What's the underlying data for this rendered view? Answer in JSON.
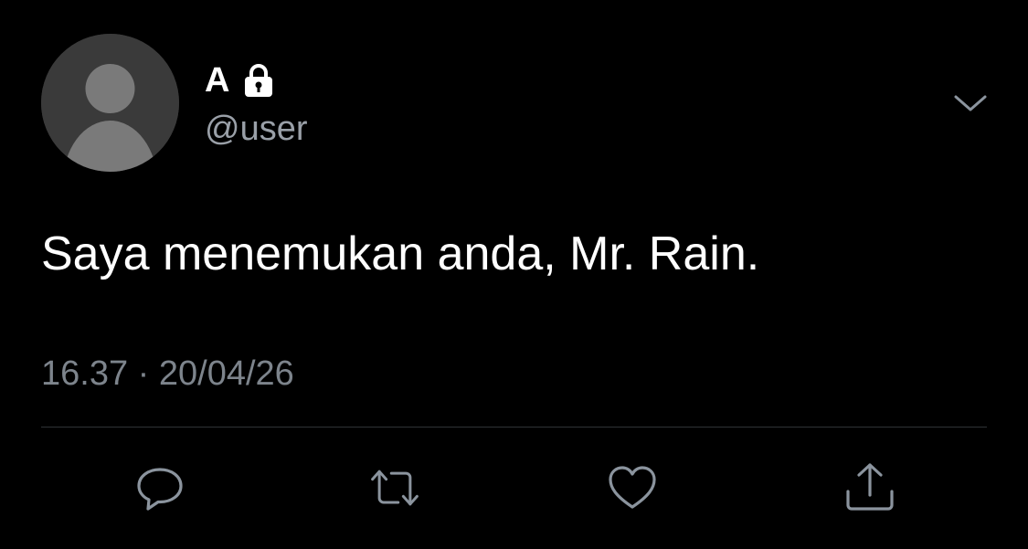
{
  "author": {
    "display_name": "A",
    "handle": "@user",
    "protected_icon": "lock-icon",
    "avatar_icon": "default-avatar-icon"
  },
  "menu": {
    "icon": "chevron-down-icon"
  },
  "tweet": {
    "text": "Saya menemukan anda, Mr. Rain.",
    "time": "16.37",
    "separator": "·",
    "date": "20/04/26"
  },
  "actions": [
    {
      "name": "reply",
      "icon": "speech-bubble-icon"
    },
    {
      "name": "retweet",
      "icon": "retweet-icon"
    },
    {
      "name": "like",
      "icon": "heart-icon"
    },
    {
      "name": "share",
      "icon": "share-upload-icon"
    }
  ],
  "colors": {
    "background": "#000000",
    "text_primary": "#ffffff",
    "text_secondary": "#7d848c",
    "icon": "#8b949e",
    "divider": "#2f3336"
  }
}
